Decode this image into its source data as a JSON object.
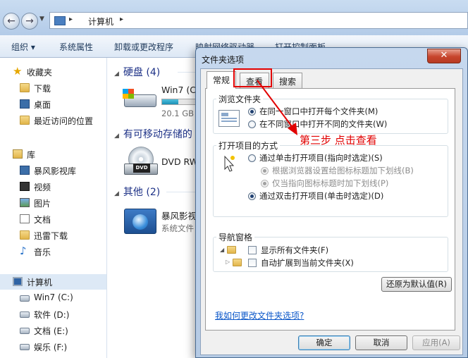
{
  "explorer": {
    "address": {
      "crumb": "计算机",
      "sep": "▸"
    },
    "toolbar": [
      "组织 ▾",
      "系统属性",
      "卸载或更改程序",
      "映射网络驱动器",
      "打开控制面板"
    ],
    "nav": {
      "favorites": "收藏夹",
      "fav_items": [
        "下载",
        "桌面",
        "最近访问的位置"
      ],
      "libraries": "库",
      "lib_items": [
        "暴风影视库",
        "视频",
        "图片",
        "文档",
        "迅雷下载",
        "音乐"
      ],
      "computer": "计算机",
      "drives": [
        "Win7 (C:)",
        "软件 (D:)",
        "文档 (E:)",
        "娱乐 (F:)"
      ]
    },
    "main": {
      "group_hdd": "硬盘 (4)",
      "c_drive_name": "Win7 (C:",
      "c_drive_free": "20.1 GB",
      "c_drive_used_fraction": 0.45,
      "group_removable": "有可移动存储的",
      "dvd_name": "DVD RW",
      "dvd_label": "DVD",
      "group_other": "其他 (2)",
      "other_name": "暴风影视库",
      "other_sub": "系统文件"
    }
  },
  "dialog": {
    "title": "文件夹选项",
    "close_glyph": "✕",
    "tabs": [
      "常规",
      "查看",
      "搜索"
    ],
    "browse": {
      "legend": "浏览文件夹",
      "opt1": "在同一窗口中打开每个文件夹(M)",
      "opt2": "在不同窗口中打开不同的文件夹(W)"
    },
    "click": {
      "legend": "打开项目的方式",
      "opt1": "通过单击打开项目(指向时选定)(S)",
      "sub1": "根据浏览器设置给图标标题加下划线(B)",
      "sub2": "仅当指向图标标题时加下划线(P)",
      "opt2": "通过双击打开项目(单击时选定)(D)"
    },
    "nav": {
      "legend": "导航窗格",
      "chk1": "显示所有文件夹(F)",
      "chk2": "自动扩展到当前文件夹(X)"
    },
    "restore": "还原为默认值(R)",
    "help_link": "我如何更改文件夹选项?",
    "ok": "确定",
    "cancel": "取消",
    "apply": "应用(A)"
  },
  "annotation": {
    "text": "第三步 点击查看",
    "color": "#e10000"
  }
}
